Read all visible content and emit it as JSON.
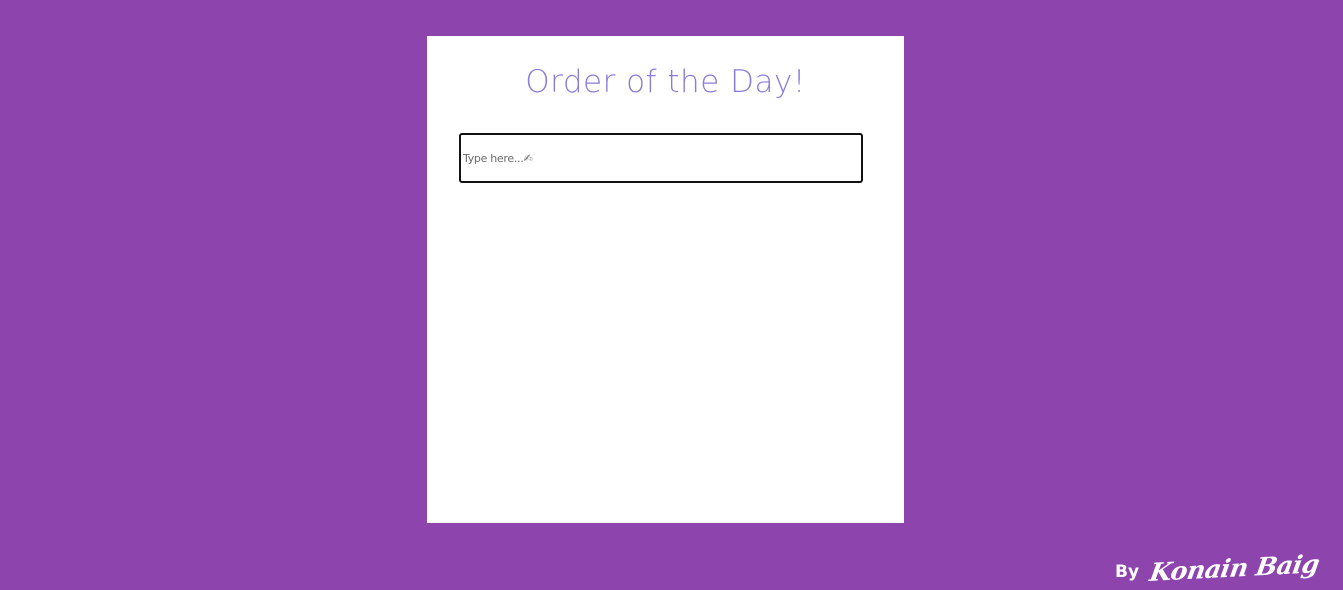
{
  "app": {
    "title": "Order of the Day!"
  },
  "todo_input": {
    "placeholder": "Type here...✍",
    "value": ""
  },
  "footer": {
    "by_label": "By",
    "author": "Konain Baig"
  },
  "colors": {
    "background": "#8e44ad",
    "card": "#ffffff",
    "title": "#8a7cd9",
    "input_border": "#111111",
    "footer_text": "#ffffff"
  }
}
